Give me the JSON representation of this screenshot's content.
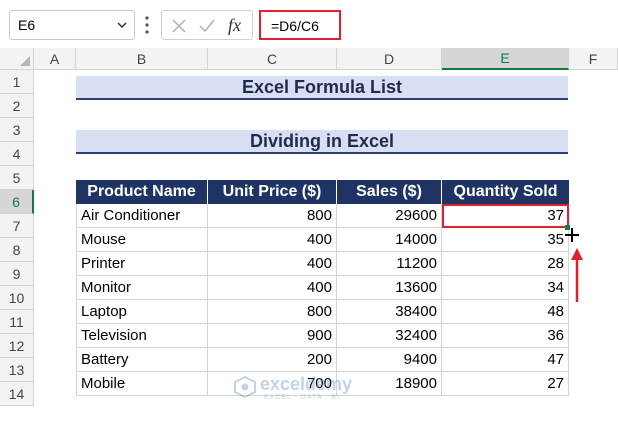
{
  "formula_bar": {
    "name_box": "E6",
    "formula": "=D6/C6",
    "fx_label": "fx"
  },
  "columns": [
    "A",
    "B",
    "C",
    "D",
    "E",
    "F"
  ],
  "rows": [
    "1",
    "2",
    "3",
    "4",
    "5",
    "6",
    "7",
    "8",
    "9",
    "10",
    "11",
    "12",
    "13",
    "14"
  ],
  "sheet": {
    "title": "Excel Formula List",
    "subtitle": "Dividing in Excel",
    "table": {
      "headers": [
        "Product Name",
        "Unit Price ($)",
        "Sales ($)",
        "Quantity Sold"
      ],
      "rows": [
        [
          "Air Conditioner",
          "800",
          "29600",
          "37"
        ],
        [
          "Mouse",
          "400",
          "14000",
          "35"
        ],
        [
          "Printer",
          "400",
          "11200",
          "28"
        ],
        [
          "Monitor",
          "400",
          "13600",
          "34"
        ],
        [
          "Laptop",
          "800",
          "38400",
          "48"
        ],
        [
          "Television",
          "900",
          "32400",
          "36"
        ],
        [
          "Battery",
          "200",
          "9400",
          "47"
        ],
        [
          "Mobile",
          "700",
          "18900",
          "27"
        ]
      ]
    }
  },
  "watermark": {
    "brand": "exceldemy",
    "tagline": "EXCEL · DATA · BI"
  },
  "colors": {
    "header_bg": "#1f3464",
    "title_bg": "#d9dff3",
    "highlight_red": "#e0202a",
    "excel_green": "#107c41"
  }
}
